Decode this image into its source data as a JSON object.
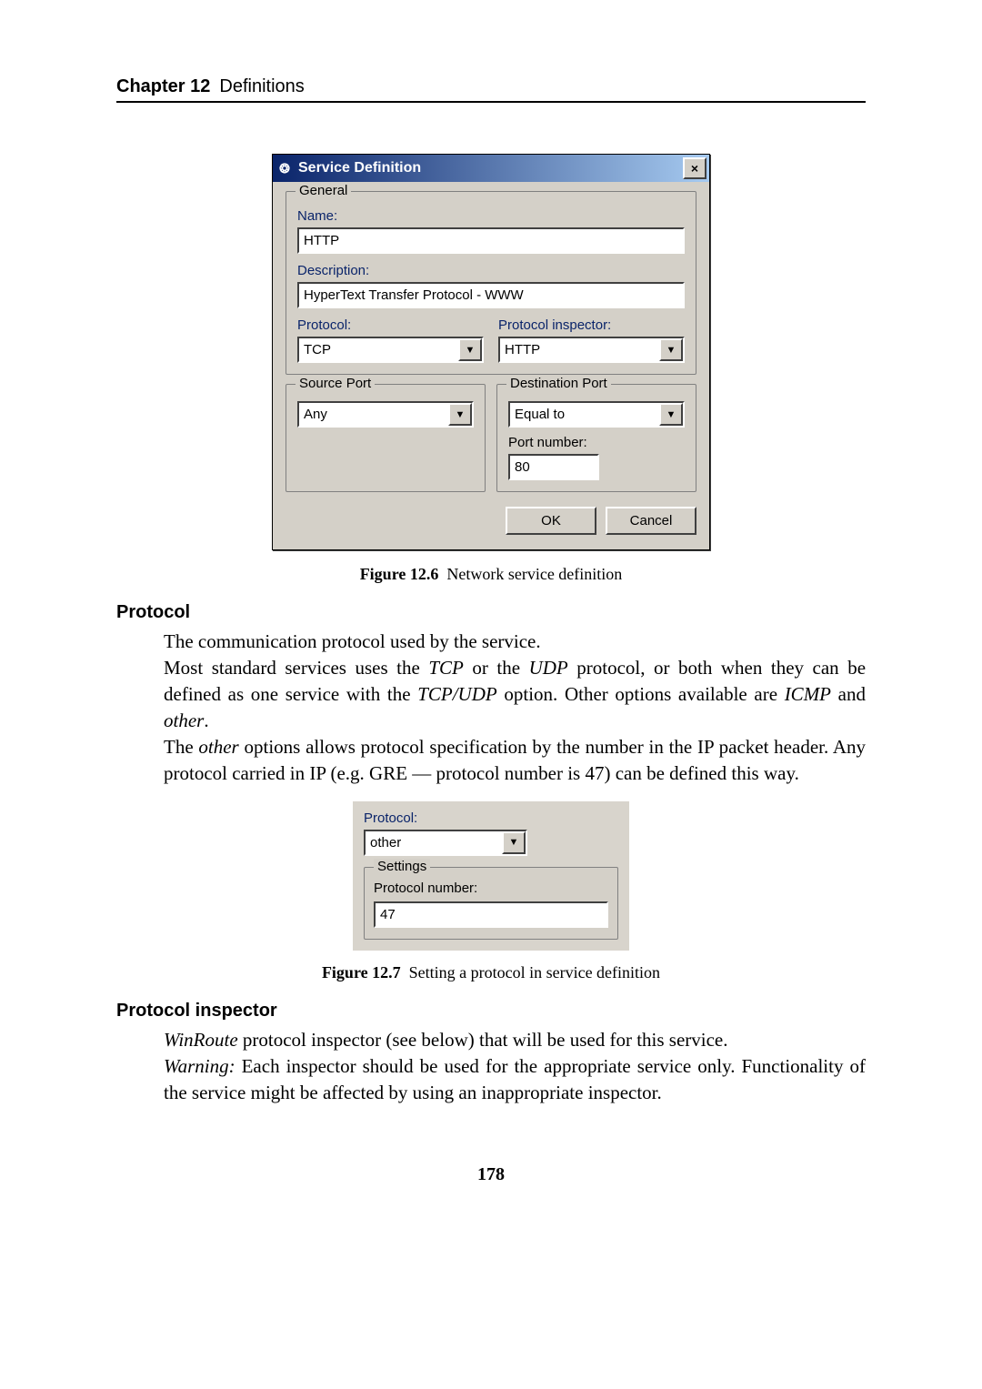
{
  "header": {
    "chapter": "Chapter 12",
    "title": "Definitions"
  },
  "dialog1": {
    "title": "Service Definition",
    "close_x": "×",
    "general_legend": "General",
    "name_label": "Name:",
    "name_value": "HTTP",
    "desc_label": "Description:",
    "desc_value": "HyperText Transfer Protocol - WWW",
    "protocol_label": "Protocol:",
    "protocol_value": "TCP",
    "inspector_label": "Protocol inspector:",
    "inspector_value": "HTTP",
    "source_legend": "Source Port",
    "source_combo": "Any",
    "dest_legend": "Destination Port",
    "dest_combo": "Equal to",
    "portnum_label": "Port number:",
    "portnum_value": "80",
    "ok": "OK",
    "cancel": "Cancel"
  },
  "fig1": {
    "label": "Figure 12.6",
    "caption": "Network service definition"
  },
  "protocol_section": {
    "title": "Protocol",
    "p1": "The communication protocol used by the service.",
    "p2a": "Most standard services uses the ",
    "p2_tcp": "TCP",
    "p2b": " or the ",
    "p2_udp": "UDP",
    "p2c": " protocol, or both when they can be defined as one service with the ",
    "p2_tcpudp": "TCP/UDP",
    "p2d": " option. Other options available are ",
    "p2_icmp": "ICMP",
    "p2e": " and ",
    "p2_other": "other",
    "p2f": ".",
    "p3a": "The ",
    "p3_other": "other",
    "p3b": " options allows protocol specification by the number in the IP packet header.  Any protocol carried in IP (e.g.  GRE — protocol number is 47) can be defined this way."
  },
  "dialog2": {
    "protocol_label": "Protocol:",
    "protocol_value": "other",
    "settings_legend": "Settings",
    "protonum_label": "Protocol number:",
    "protonum_value": "47"
  },
  "fig2": {
    "label": "Figure 12.7",
    "caption": "Setting a protocol in service definition"
  },
  "inspector_section": {
    "title": "Protocol inspector",
    "p1a_i": "WinRoute",
    "p1b": " protocol inspector (see below) that will be used for this service.",
    "p2a_i": "Warning:",
    "p2b": " Each inspector should be used for the appropriate service only. Functionality of the service might be affected by using an inappropriate inspector."
  },
  "pagenum": "178"
}
